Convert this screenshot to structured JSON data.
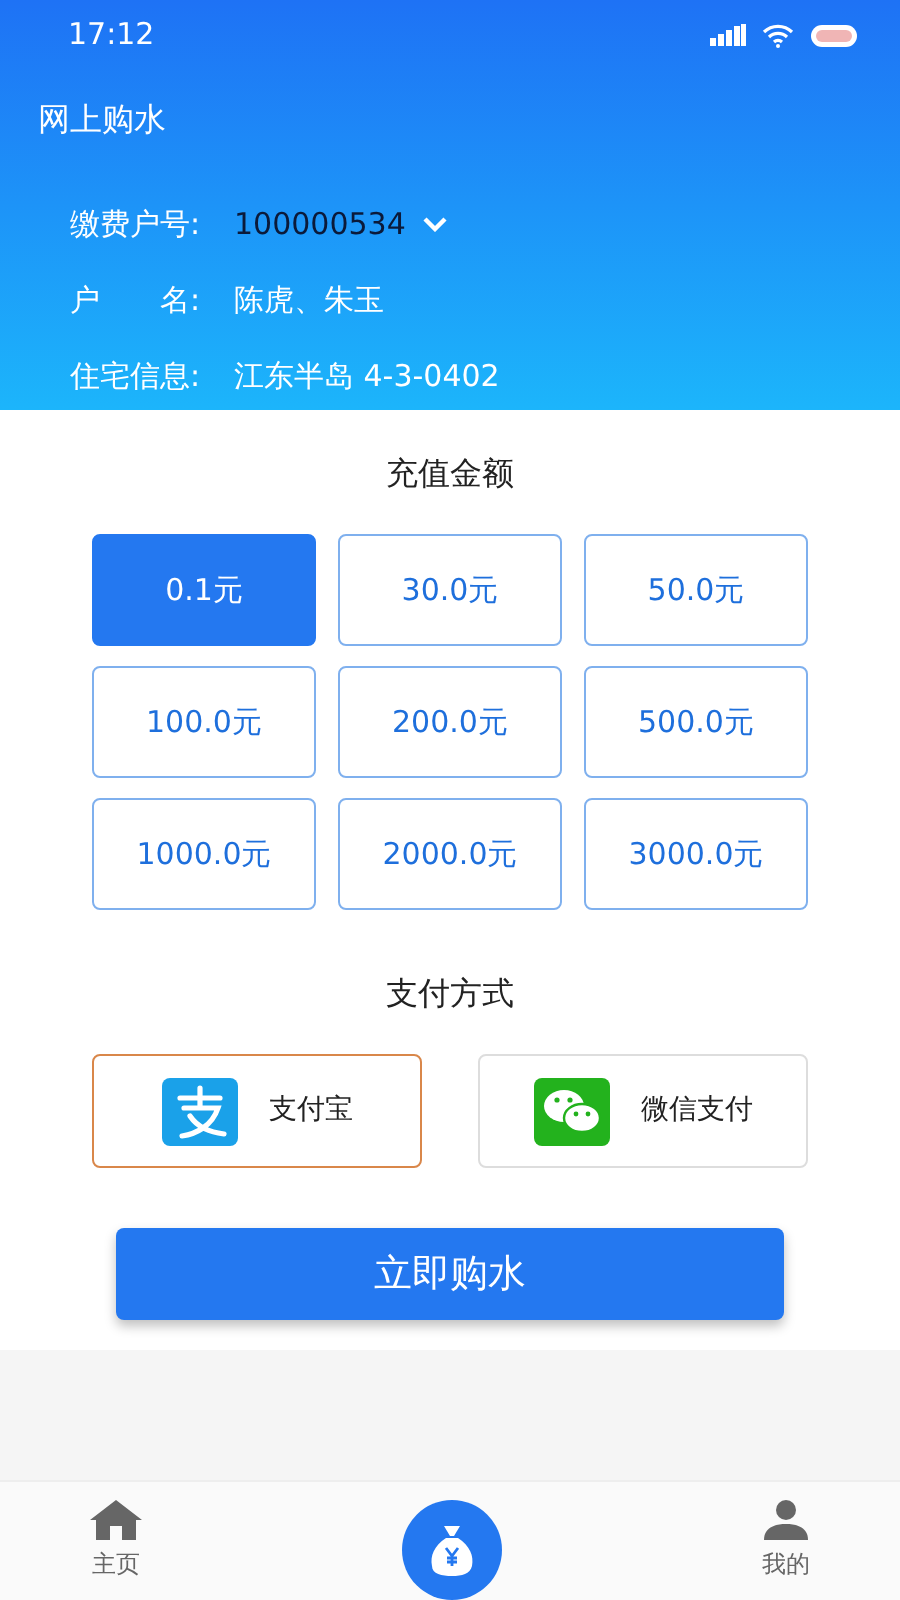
{
  "status_bar": {
    "time": "17:12"
  },
  "header": {
    "title": "网上购水",
    "fields": [
      {
        "label": "缴费户号:",
        "value": "100000534",
        "kind": "dropdown"
      },
      {
        "label": "户　　名:",
        "value": "陈虎、朱玉",
        "kind": "text"
      },
      {
        "label": "住宅信息:",
        "value": "江东半岛 4-3-0402",
        "kind": "text"
      }
    ]
  },
  "amount_section": {
    "title": "充值金额",
    "options": [
      {
        "label": "0.1元",
        "selected": true
      },
      {
        "label": "30.0元",
        "selected": false
      },
      {
        "label": "50.0元",
        "selected": false
      },
      {
        "label": "100.0元",
        "selected": false
      },
      {
        "label": "200.0元",
        "selected": false
      },
      {
        "label": "500.0元",
        "selected": false
      },
      {
        "label": "1000.0元",
        "selected": false
      },
      {
        "label": "2000.0元",
        "selected": false
      },
      {
        "label": "3000.0元",
        "selected": false
      }
    ]
  },
  "payment_section": {
    "title": "支付方式",
    "methods": [
      {
        "label": "支付宝",
        "kind": "alipay",
        "selected": true
      },
      {
        "label": "微信支付",
        "kind": "wechat",
        "selected": false
      }
    ]
  },
  "buy_button": "立即购水",
  "tab_bar": [
    {
      "label": "主页",
      "kind": "home"
    },
    {
      "kind": "center"
    },
    {
      "label": "我的",
      "kind": "profile"
    }
  ]
}
